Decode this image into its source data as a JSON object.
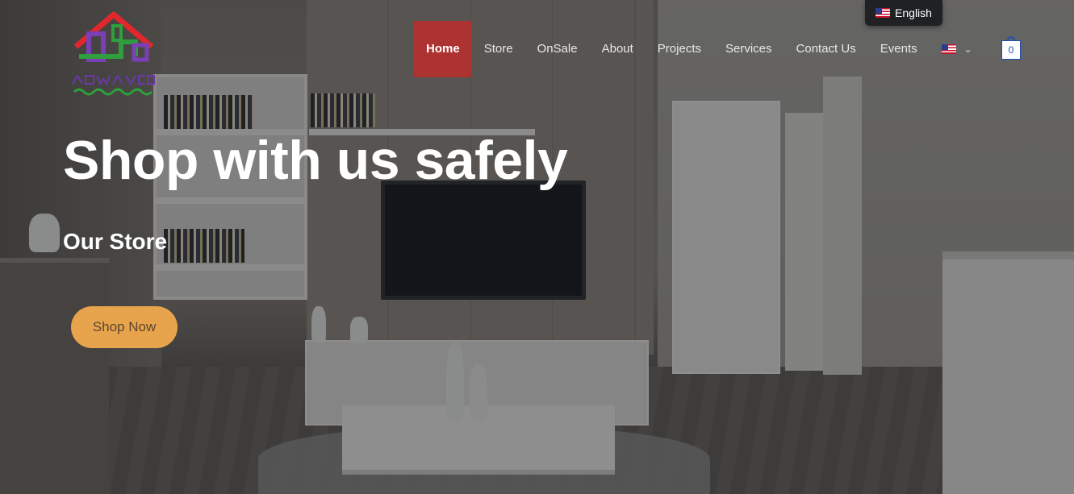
{
  "brand": {
    "logo_icon": "house-logo-icon"
  },
  "language": {
    "current": "English",
    "flag_icon": "us-flag-icon"
  },
  "nav": {
    "items": [
      {
        "label": "Home",
        "active": true
      },
      {
        "label": "Store"
      },
      {
        "label": "OnSale"
      },
      {
        "label": "About"
      },
      {
        "label": "Projects"
      },
      {
        "label": "Services"
      },
      {
        "label": "Contact Us"
      },
      {
        "label": "Events"
      }
    ],
    "lang_flag_icon": "us-flag-icon",
    "lang_chevron_icon": "chevron-down-icon"
  },
  "cart": {
    "count": "0",
    "icon": "shopping-bag-icon",
    "border_color": "#1f4fb0"
  },
  "hero": {
    "title": "Shop with us safely",
    "subtitle": "Our Store",
    "cta_label": "Shop Now",
    "cta_color": "#e8a44c",
    "active_nav_color": "#c82828"
  }
}
